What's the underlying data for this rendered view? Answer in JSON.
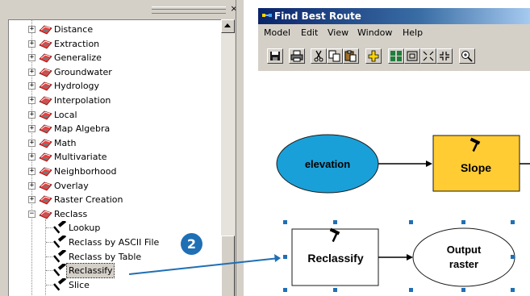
{
  "toolbox": {
    "close_glyph": "×",
    "items": [
      {
        "label": "Distance",
        "expander": "+"
      },
      {
        "label": "Extraction",
        "expander": "+"
      },
      {
        "label": "Generalize",
        "expander": "+"
      },
      {
        "label": "Groundwater",
        "expander": "+"
      },
      {
        "label": "Hydrology",
        "expander": "+"
      },
      {
        "label": "Interpolation",
        "expander": "+"
      },
      {
        "label": "Local",
        "expander": "+"
      },
      {
        "label": "Map Algebra",
        "expander": "+"
      },
      {
        "label": "Math",
        "expander": "+"
      },
      {
        "label": "Multivariate",
        "expander": "+"
      },
      {
        "label": "Neighborhood",
        "expander": "+"
      },
      {
        "label": "Overlay",
        "expander": "+"
      },
      {
        "label": "Raster Creation",
        "expander": "+"
      },
      {
        "label": "Reclass",
        "expander": "−"
      }
    ],
    "tools": [
      {
        "label": "Lookup"
      },
      {
        "label": "Reclass by ASCII File"
      },
      {
        "label": "Reclass by Table"
      },
      {
        "label": "Reclassify",
        "selected": true
      },
      {
        "label": "Slice"
      }
    ]
  },
  "window": {
    "title": "Find Best Route",
    "menu": [
      "Model",
      "Edit",
      "View",
      "Window",
      "Help"
    ],
    "toolbar_icons": [
      "save-icon",
      "print-icon",
      "cut-icon",
      "copy-icon",
      "paste-icon",
      "add-data-icon",
      "select-all-icon",
      "full-extent-icon",
      "zoom-in-fixed-icon",
      "zoom-out-fixed-icon",
      "zoom-in-icon"
    ]
  },
  "model": {
    "elevation": "elevation",
    "slope": "Slope",
    "reclassify": "Reclassify",
    "output_line1": "Output",
    "output_line2": "raster"
  },
  "callout": {
    "number": "2"
  },
  "colors": {
    "data_blue": "#1aa0d8",
    "tool_yellow": "#ffcc33",
    "callout_blue": "#1f6fb5",
    "title_bar": "#0a246a"
  }
}
